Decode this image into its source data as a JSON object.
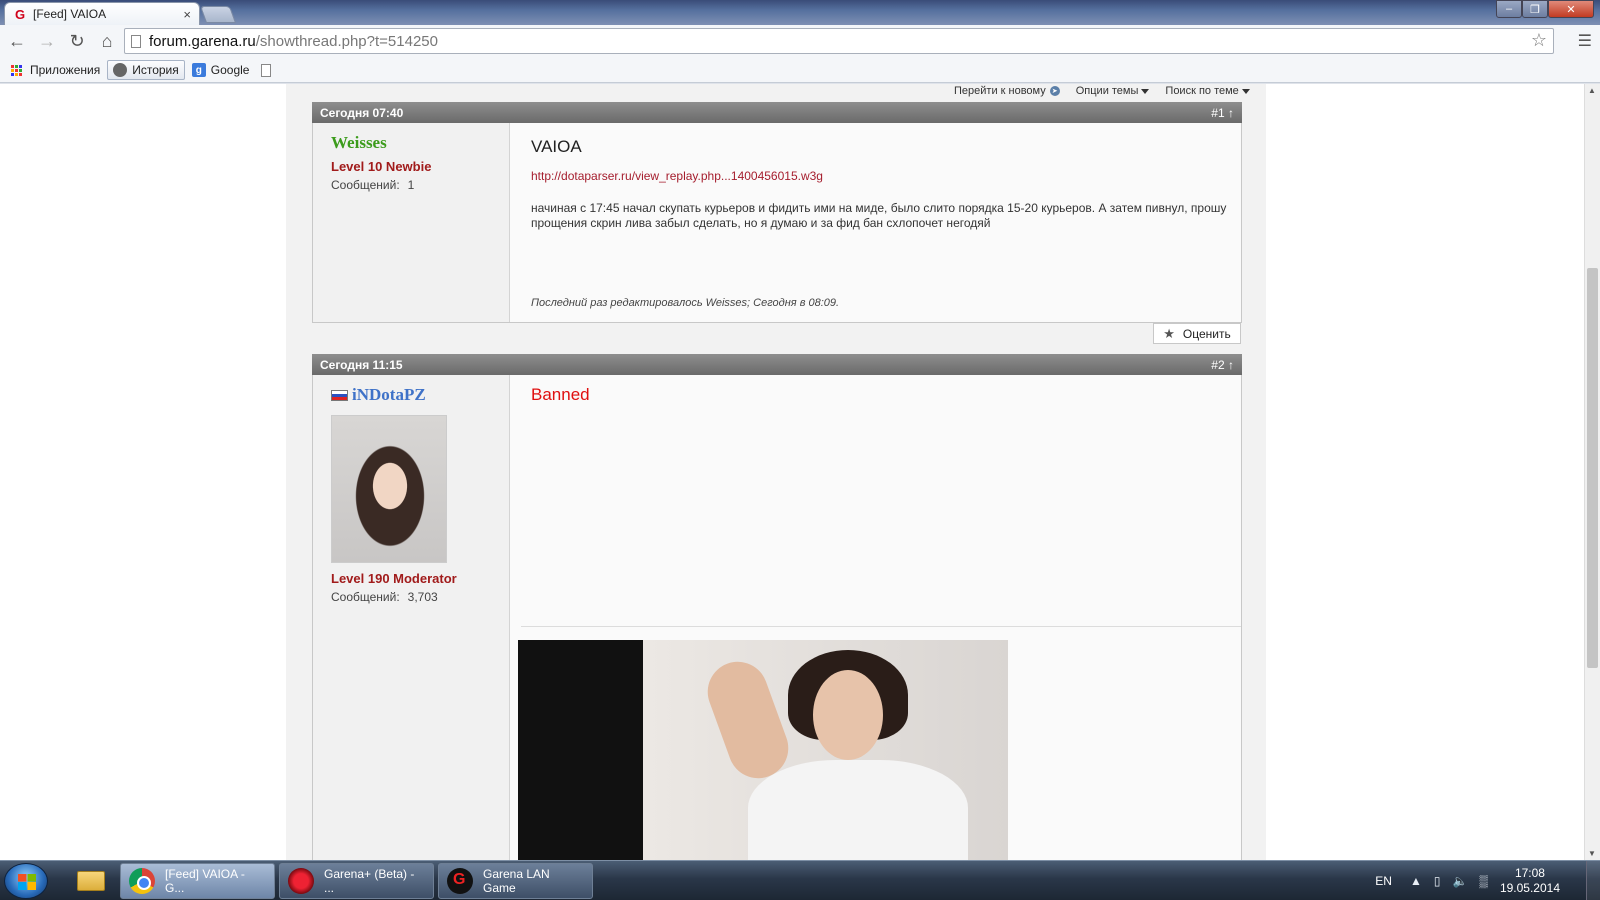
{
  "browser": {
    "tab_title": "[Feed] VAIOA",
    "tab_close": "×",
    "url_host": "forum.garena.ru",
    "url_path": "/showthread.php?t=514250",
    "window_controls": [
      "–",
      "❐",
      "✕"
    ]
  },
  "bookmarks": [
    {
      "label": "Приложения",
      "icon": "apps-grid-icon"
    },
    {
      "label": "История",
      "icon": "clock-icon"
    },
    {
      "label": "Google",
      "icon": "google-plus-icon"
    }
  ],
  "thread_tools": {
    "next_new": "Перейти к новому",
    "thread_options": "Опции темы",
    "search_thread": "Поиск по теме"
  },
  "posts": [
    {
      "date": "Сегодня 07:40",
      "number": "#1",
      "username": "Weisses",
      "user_title": "Level 10 Newbie",
      "posts_label": "Сообщений:",
      "posts_count": "1",
      "title": "VAIOA",
      "link": "http://dotaparser.ru/view_replay.php...1400456015.w3g",
      "text": "начиная с 17:45 начал скупать курьеров и фидить ими на миде, было слито порядка 15-20 курьеров. А затем пивнул, прошу прощения скрин лива забыл сделать, но я думаю и за фид бан схлопочет негодяй",
      "edit_note": "Последний раз редактировалось Weisses; Сегодня в 08:09.",
      "rate_label": "Оценить"
    },
    {
      "date": "Сегодня 11:15",
      "number": "#2",
      "username": "iNDotaPZ",
      "user_title": "Level 190 Moderator",
      "posts_label": "Сообщений:",
      "posts_count": "3,703",
      "title": "Banned"
    }
  ],
  "taskbar": {
    "tasks": [
      {
        "label": "[Feed] VAIOA - G..."
      },
      {
        "label": "Garena+ (Beta) - ..."
      },
      {
        "label": "Garena LAN Game"
      }
    ],
    "lang": "EN",
    "time": "17:08",
    "date": "19.05.2014"
  },
  "colors": {
    "username_green": "#3c9c1c",
    "username_blue": "#3f72c8",
    "user_title_red": "#a11b1b",
    "banned_red": "#e01010",
    "post_header_gray": "#7a7a7a"
  }
}
